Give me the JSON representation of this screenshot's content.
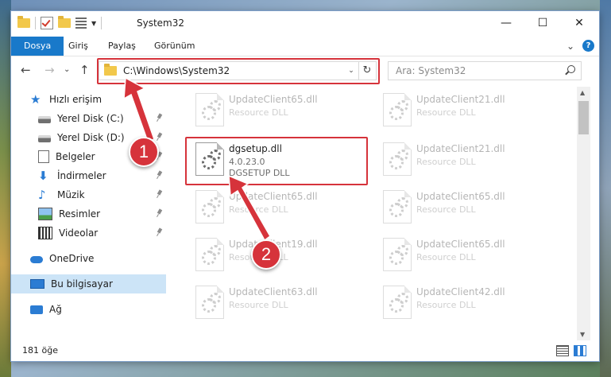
{
  "window": {
    "title": "System32",
    "minimize": "—",
    "maximize": "☐",
    "close": "✕"
  },
  "ribbon": {
    "tabs": [
      "Dosya",
      "Giriş",
      "Paylaş",
      "Görünüm"
    ],
    "expand": "⌄",
    "help": "?"
  },
  "nav": {
    "back": "←",
    "forward": "→",
    "dropdown": "⌄",
    "up": "↑",
    "address": "C:\\Windows\\System32",
    "address_dd": "⌄",
    "refresh": "↻",
    "search_placeholder": "Ara: System32"
  },
  "sidebar": {
    "items": [
      {
        "label": "Hızlı erişim",
        "icon": "star-icon"
      },
      {
        "label": "Yerel Disk (C:)",
        "icon": "drive-icon"
      },
      {
        "label": "Yerel Disk (D:)",
        "icon": "drive-icon"
      },
      {
        "label": "Belgeler",
        "icon": "documents-icon"
      },
      {
        "label": "İndirmeler",
        "icon": "download-icon"
      },
      {
        "label": "Müzik",
        "icon": "music-icon"
      },
      {
        "label": "Resimler",
        "icon": "pictures-icon"
      },
      {
        "label": "Videolar",
        "icon": "videos-icon"
      },
      {
        "label": "OneDrive",
        "icon": "cloud-icon"
      },
      {
        "label": "Bu bilgisayar",
        "icon": "computer-icon"
      },
      {
        "label": "Ağ",
        "icon": "network-icon"
      }
    ]
  },
  "files": [
    {
      "name": "UpdateClient65.dll",
      "type": "Resource DLL",
      "faded": true
    },
    {
      "name": "UpdateClient21.dll",
      "type": "Resource DLL",
      "faded": true
    },
    {
      "name": "dgsetup.dll",
      "version": "4.0.23.0",
      "type": "DGSETUP DLL",
      "faded": false
    },
    {
      "name": "UpdateClient21.dll",
      "type": "Resource DLL",
      "faded": true
    },
    {
      "name": "UpdateClient65.dll",
      "type": "Resource DLL",
      "faded": true
    },
    {
      "name": "UpdateClient65.dll",
      "type": "Resource DLL",
      "faded": true
    },
    {
      "name": "UpdateClient19.dll",
      "type": "Resource DLL",
      "faded": true
    },
    {
      "name": "UpdateClient65.dll",
      "type": "Resource DLL",
      "faded": true
    },
    {
      "name": "UpdateClient63.dll",
      "type": "Resource DLL",
      "faded": true
    },
    {
      "name": "UpdateClient42.dll",
      "type": "Resource DLL",
      "faded": true
    }
  ],
  "status": {
    "count": "181 öğe"
  },
  "annotations": {
    "step1": "1",
    "step2": "2",
    "color": "#d6333b"
  },
  "colors": {
    "accent": "#1979ca",
    "selection": "#cce4f7",
    "highlight": "#d6333b"
  }
}
